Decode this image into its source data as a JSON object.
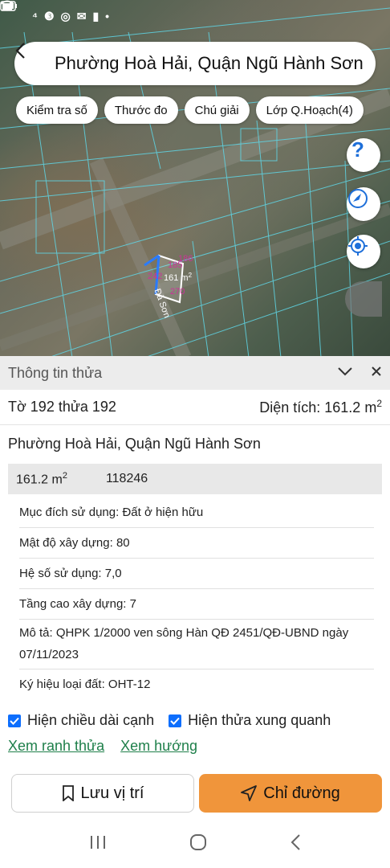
{
  "status_bar": {
    "left_icons": [
      "notification-icon",
      "circle-icon",
      "circle-icon",
      "email-icon",
      "battery-small-icon",
      "dot-icon"
    ],
    "right_icons": [
      "wifi-icon",
      "signal-icon",
      "battery-icon"
    ]
  },
  "header": {
    "title": "Phường Hoà Hải, Quận Ngũ Hành Sơn"
  },
  "chips": [
    "Kiểm tra số",
    "Thước đo",
    "Chú giải",
    "Lớp Q.Hoạch(4)"
  ],
  "map": {
    "parcel_labels": {
      "edge_top": "185",
      "edge_top_right": "186",
      "edge_left": "242",
      "area": "161 m",
      "area_sup": "2",
      "edge_bottom": "270",
      "road": "Đà Sơn"
    }
  },
  "panel": {
    "title": "Thông tin thửa",
    "summary_left": "Tờ 192 thửa 192",
    "summary_right": "Diện tích: 161.2 m",
    "summary_sup": "2",
    "location": "Phường Hoà Hải, Quận Ngũ Hành Sơn",
    "card_area": "161.2 m",
    "card_area_sup": "2",
    "card_code": "118246",
    "rows": [
      "Mục đích sử dụng: Đất ở hiện hữu",
      "Mật độ xây dựng: 80",
      "Hệ số sử dụng: 7,0",
      "Tầng cao xây dựng: 7",
      "Mô tả: QHPK 1/2000 ven sông Hàn QĐ 2451/QĐ-UBND ngày 07/11/2023",
      "Ký hiệu loại đất: OHT-12"
    ],
    "check1": "Hiện chiều dài cạnh",
    "check2": "Hiện thửa xung quanh",
    "link1": "Xem ranh thửa",
    "link2": "Xem hướng",
    "btn_save": "Lưu vị trí",
    "btn_route": "Chỉ đường"
  },
  "colors": {
    "accent": "#f0953b",
    "link": "#1e7f4a",
    "checkbox": "#0d6efd"
  }
}
